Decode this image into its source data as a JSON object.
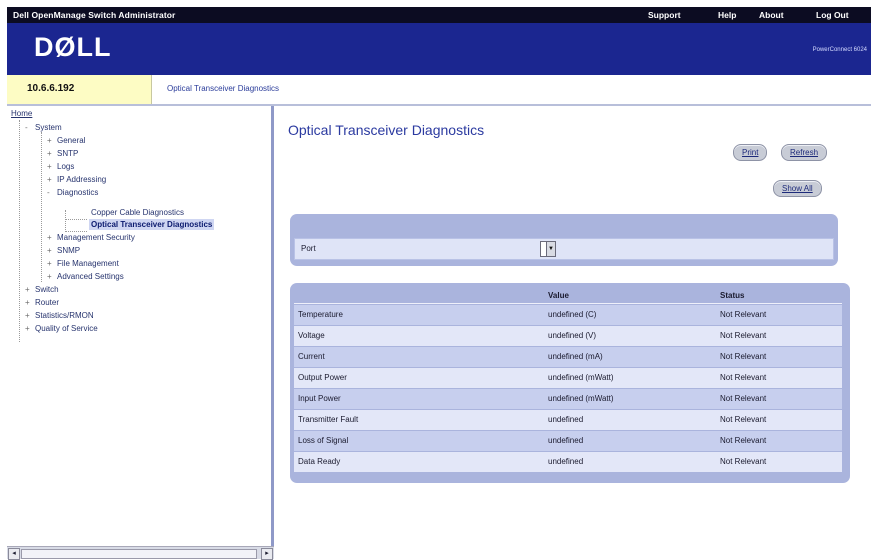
{
  "topbar": {
    "title": "Dell OpenManage Switch Administrator",
    "links": [
      "Support",
      "Help",
      "About",
      "Log Out"
    ]
  },
  "brand": {
    "logo": "DØLL",
    "product": "PowerConnect 6024"
  },
  "strip": {
    "ip": "10.6.6.192",
    "breadcrumb": "Optical Transceiver Diagnostics"
  },
  "tree": [
    {
      "label": "Home",
      "depth": 0,
      "expander": ""
    },
    {
      "label": "System",
      "depth": 1,
      "expander": "-"
    },
    {
      "label": "General",
      "depth": 2,
      "expander": "+"
    },
    {
      "label": "SNTP",
      "depth": 2,
      "expander": "+"
    },
    {
      "label": "Logs",
      "depth": 2,
      "expander": "+"
    },
    {
      "label": "IP Addressing",
      "depth": 2,
      "expander": "+"
    },
    {
      "label": "Diagnostics",
      "depth": 2,
      "expander": "-"
    },
    {
      "label": "Copper Cable Diagnostics",
      "depth": 3,
      "expander": ""
    },
    {
      "label": "Optical Transceiver Diagnostics",
      "depth": 3,
      "expander": "",
      "selected": true
    },
    {
      "label": "Management Security",
      "depth": 2,
      "expander": "+"
    },
    {
      "label": "SNMP",
      "depth": 2,
      "expander": "+"
    },
    {
      "label": "File Management",
      "depth": 2,
      "expander": "+"
    },
    {
      "label": "Advanced Settings",
      "depth": 2,
      "expander": "+"
    },
    {
      "label": "Switch",
      "depth": 1,
      "expander": "+"
    },
    {
      "label": "Router",
      "depth": 1,
      "expander": "+"
    },
    {
      "label": "Statistics/RMON",
      "depth": 1,
      "expander": "+"
    },
    {
      "label": "Quality of Service",
      "depth": 1,
      "expander": "+"
    }
  ],
  "page": {
    "title": "Optical Transceiver Diagnostics",
    "buttons": {
      "print": "Print",
      "refresh": "Refresh",
      "show_all": "Show All"
    },
    "port_label": "Port",
    "port_value": ""
  },
  "table": {
    "headers": [
      "",
      "Value",
      "Status"
    ],
    "rows": [
      [
        "Temperature",
        "undefined (C)",
        "Not Relevant"
      ],
      [
        "Voltage",
        "undefined (V)",
        "Not Relevant"
      ],
      [
        "Current",
        "undefined (mA)",
        "Not Relevant"
      ],
      [
        "Output Power",
        "undefined (mWatt)",
        "Not Relevant"
      ],
      [
        "Input Power",
        "undefined (mWatt)",
        "Not Relevant"
      ],
      [
        "Transmitter Fault",
        "undefined",
        "Not Relevant"
      ],
      [
        "Loss of Signal",
        "undefined",
        "Not Relevant"
      ],
      [
        "Data Ready",
        "undefined",
        "Not Relevant"
      ]
    ]
  },
  "scrollbar": {
    "left": "◂",
    "right": "▸"
  },
  "colors": {
    "topbar": "#0c0c22",
    "brand_band": "#1b2690",
    "ip_cell": "#fdfcc4",
    "panel": "#aab4dd",
    "row_odd": "#c7cfee",
    "row_even": "#e3e7f8",
    "title": "#2b3aa0"
  }
}
